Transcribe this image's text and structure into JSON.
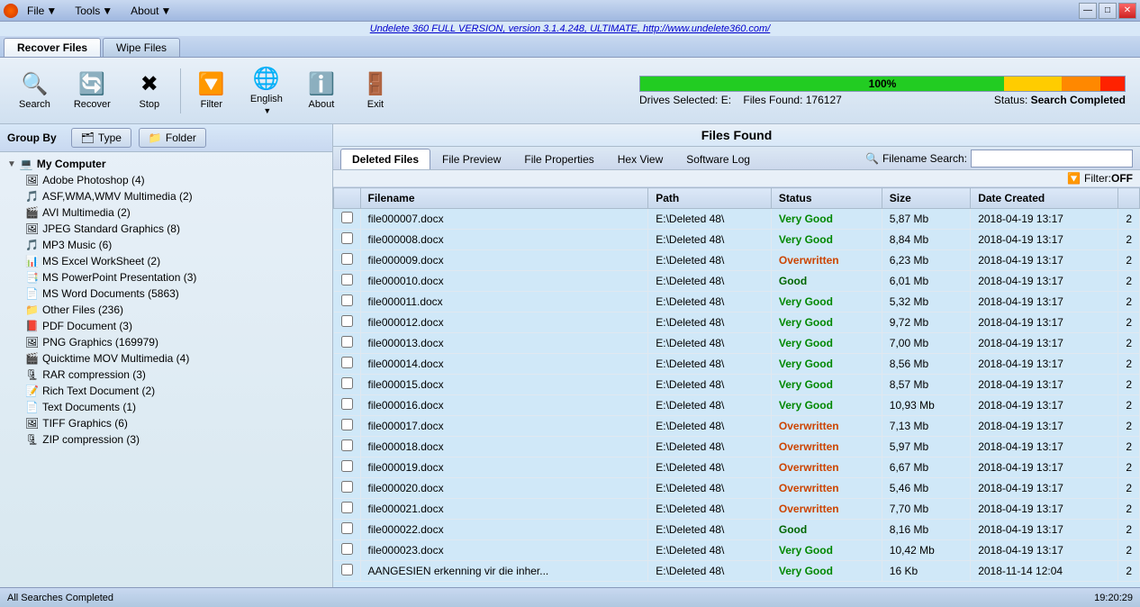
{
  "app": {
    "title": "Undelete 360",
    "link": "Undelete 360 FULL VERSION, version 3.1.4.248, ULTIMATE, http://www.undelete360.com/",
    "link_url": "http://www.undelete360.com/"
  },
  "menu": {
    "file_label": "File",
    "tools_label": "Tools",
    "about_label": "About"
  },
  "tabs": {
    "recover_files": "Recover Files",
    "wipe_files": "Wipe Files"
  },
  "toolbar": {
    "search_label": "Search",
    "recover_label": "Recover",
    "stop_label": "Stop",
    "filter_label": "Filter",
    "english_label": "English",
    "about_label": "About",
    "exit_label": "Exit"
  },
  "progress": {
    "percent": "100%",
    "drives_selected": "Drives Selected: E:",
    "files_found": "Files Found: 176127",
    "status_label": "Status:",
    "status_value": "Search Completed"
  },
  "group_by": {
    "label": "Group By",
    "type_btn": "Type",
    "folder_btn": "Folder"
  },
  "tree": {
    "root_label": "My Computer",
    "items": [
      {
        "label": "Adobe Photoshop (4)",
        "icon": "🖼"
      },
      {
        "label": "ASF,WMA,WMV Multimedia (2)",
        "icon": "🎵"
      },
      {
        "label": "AVI Multimedia (2)",
        "icon": "🎬"
      },
      {
        "label": "JPEG Standard Graphics (8)",
        "icon": "🖼"
      },
      {
        "label": "MP3 Music (6)",
        "icon": "🎵"
      },
      {
        "label": "MS Excel WorkSheet (2)",
        "icon": "📊"
      },
      {
        "label": "MS PowerPoint Presentation (3)",
        "icon": "📑"
      },
      {
        "label": "MS Word Documents (5863)",
        "icon": "📄"
      },
      {
        "label": "Other Files (236)",
        "icon": "📁"
      },
      {
        "label": "PDF Document (3)",
        "icon": "📕"
      },
      {
        "label": "PNG Graphics (169979)",
        "icon": "🖼"
      },
      {
        "label": "Quicktime MOV Multimedia (4)",
        "icon": "🎬"
      },
      {
        "label": "RAR compression (3)",
        "icon": "🗜"
      },
      {
        "label": "Rich Text Document (2)",
        "icon": "📝"
      },
      {
        "label": "Text Documents (1)",
        "icon": "📄"
      },
      {
        "label": "TIFF Graphics (6)",
        "icon": "🖼"
      },
      {
        "label": "ZIP compression (3)",
        "icon": "🗜"
      }
    ]
  },
  "files_found_header": "Files Found",
  "inner_tabs": [
    {
      "label": "Deleted Files",
      "active": true
    },
    {
      "label": "File Preview",
      "active": false
    },
    {
      "label": "File Properties",
      "active": false
    },
    {
      "label": "Hex View",
      "active": false
    },
    {
      "label": "Software Log",
      "active": false
    }
  ],
  "filename_search_label": "Filename Search:",
  "filter_label": "Filter:",
  "filter_value": "OFF",
  "table_headers": [
    "",
    "Filename",
    "Path",
    "Status",
    "Size",
    "Date Created",
    ""
  ],
  "files": [
    {
      "name": "file000007.docx",
      "path": "E:\\Deleted 48\\",
      "status": "Very Good",
      "status_class": "status-vg",
      "size": "5,87 Mb",
      "date": "2018-04-19 13:17",
      "extra": "2"
    },
    {
      "name": "file000008.docx",
      "path": "E:\\Deleted 48\\",
      "status": "Very Good",
      "status_class": "status-vg",
      "size": "8,84 Mb",
      "date": "2018-04-19 13:17",
      "extra": "2"
    },
    {
      "name": "file000009.docx",
      "path": "E:\\Deleted 48\\",
      "status": "Overwritten",
      "status_class": "status-ow",
      "size": "6,23 Mb",
      "date": "2018-04-19 13:17",
      "extra": "2"
    },
    {
      "name": "file000010.docx",
      "path": "E:\\Deleted 48\\",
      "status": "Good",
      "status_class": "status-good",
      "size": "6,01 Mb",
      "date": "2018-04-19 13:17",
      "extra": "2"
    },
    {
      "name": "file000011.docx",
      "path": "E:\\Deleted 48\\",
      "status": "Very Good",
      "status_class": "status-vg",
      "size": "5,32 Mb",
      "date": "2018-04-19 13:17",
      "extra": "2"
    },
    {
      "name": "file000012.docx",
      "path": "E:\\Deleted 48\\",
      "status": "Very Good",
      "status_class": "status-vg",
      "size": "9,72 Mb",
      "date": "2018-04-19 13:17",
      "extra": "2"
    },
    {
      "name": "file000013.docx",
      "path": "E:\\Deleted 48\\",
      "status": "Very Good",
      "status_class": "status-vg",
      "size": "7,00 Mb",
      "date": "2018-04-19 13:17",
      "extra": "2"
    },
    {
      "name": "file000014.docx",
      "path": "E:\\Deleted 48\\",
      "status": "Very Good",
      "status_class": "status-vg",
      "size": "8,56 Mb",
      "date": "2018-04-19 13:17",
      "extra": "2"
    },
    {
      "name": "file000015.docx",
      "path": "E:\\Deleted 48\\",
      "status": "Very Good",
      "status_class": "status-vg",
      "size": "8,57 Mb",
      "date": "2018-04-19 13:17",
      "extra": "2"
    },
    {
      "name": "file000016.docx",
      "path": "E:\\Deleted 48\\",
      "status": "Very Good",
      "status_class": "status-vg",
      "size": "10,93 Mb",
      "date": "2018-04-19 13:17",
      "extra": "2"
    },
    {
      "name": "file000017.docx",
      "path": "E:\\Deleted 48\\",
      "status": "Overwritten",
      "status_class": "status-ow",
      "size": "7,13 Mb",
      "date": "2018-04-19 13:17",
      "extra": "2"
    },
    {
      "name": "file000018.docx",
      "path": "E:\\Deleted 48\\",
      "status": "Overwritten",
      "status_class": "status-ow",
      "size": "5,97 Mb",
      "date": "2018-04-19 13:17",
      "extra": "2"
    },
    {
      "name": "file000019.docx",
      "path": "E:\\Deleted 48\\",
      "status": "Overwritten",
      "status_class": "status-ow",
      "size": "6,67 Mb",
      "date": "2018-04-19 13:17",
      "extra": "2"
    },
    {
      "name": "file000020.docx",
      "path": "E:\\Deleted 48\\",
      "status": "Overwritten",
      "status_class": "status-ow",
      "size": "5,46 Mb",
      "date": "2018-04-19 13:17",
      "extra": "2"
    },
    {
      "name": "file000021.docx",
      "path": "E:\\Deleted 48\\",
      "status": "Overwritten",
      "status_class": "status-ow",
      "size": "7,70 Mb",
      "date": "2018-04-19 13:17",
      "extra": "2"
    },
    {
      "name": "file000022.docx",
      "path": "E:\\Deleted 48\\",
      "status": "Good",
      "status_class": "status-good",
      "size": "8,16 Mb",
      "date": "2018-04-19 13:17",
      "extra": "2"
    },
    {
      "name": "file000023.docx",
      "path": "E:\\Deleted 48\\",
      "status": "Very Good",
      "status_class": "status-vg",
      "size": "10,42 Mb",
      "date": "2018-04-19 13:17",
      "extra": "2"
    },
    {
      "name": "AANGESIEN erkenning vir die inher...",
      "path": "E:\\Deleted 48\\",
      "status": "Very Good",
      "status_class": "status-vg",
      "size": "16 Kb",
      "date": "2018-11-14 12:04",
      "extra": "2"
    }
  ],
  "status_bar": {
    "left": "All Searches Completed",
    "right": "19:20:29"
  }
}
